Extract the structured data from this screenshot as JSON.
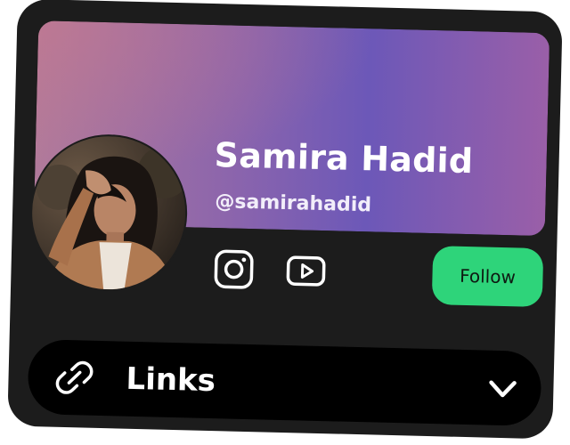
{
  "profile": {
    "name": "Samira Hadid",
    "handle": "@samirahadid"
  },
  "social": [
    {
      "icon": "instagram-icon"
    },
    {
      "icon": "youtube-icon"
    }
  ],
  "follow_button": {
    "label": "Follow"
  },
  "links": {
    "label": "Links",
    "icon": "link-icon",
    "expand_icon": "chevron-down-icon"
  },
  "colors": {
    "card_background": "#1c1c1c",
    "accent_green": "#2ed47a",
    "banner_gradient": [
      "#b07a9b",
      "#8a64ad",
      "#6c58b8",
      "#9a5fa8"
    ],
    "links_background": "#000000"
  }
}
